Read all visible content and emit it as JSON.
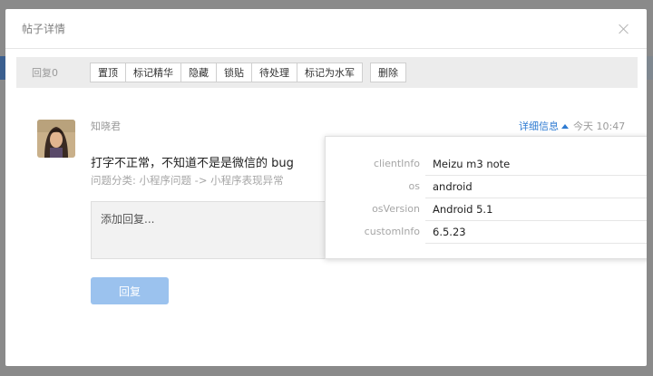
{
  "modal": {
    "title": "帖子详情"
  },
  "toolbar": {
    "reply_count": "回复0",
    "buttons": [
      "置顶",
      "标记精华",
      "隐藏",
      "锁贴",
      "待处理",
      "标记为水军"
    ],
    "delete_label": "删除"
  },
  "post": {
    "author": "知晓君",
    "content": "打字不正常，不知道不是是微信的 bug",
    "category": "问题分类: 小程序问题 -> 小程序表现异常",
    "detail_link": "详细信息",
    "timestamp": "今天 10:47"
  },
  "reply": {
    "placeholder": "添加回复...",
    "submit_label": "回复"
  },
  "details": [
    {
      "key": "clientInfo",
      "value": "Meizu m3 note"
    },
    {
      "key": "os",
      "value": "android"
    },
    {
      "key": "osVersion",
      "value": "Android 5.1"
    },
    {
      "key": "customInfo",
      "value": "6.5.23"
    }
  ],
  "colors": {
    "accent": "#2d7ad1",
    "button_disabled": "#9bc2ee",
    "overlay": "#8a8a8a"
  }
}
